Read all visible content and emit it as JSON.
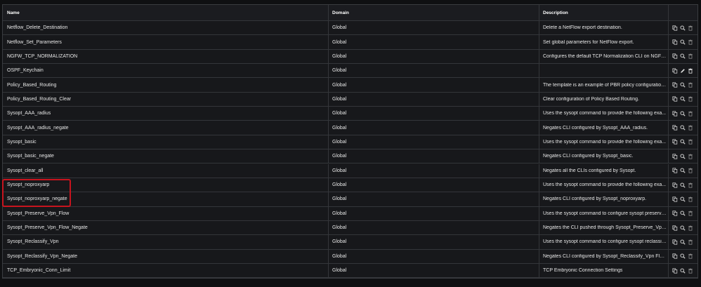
{
  "columns": {
    "name": "Name",
    "domain": "Domain",
    "description": "Description"
  },
  "rows": [
    {
      "name": "Netflow_Delete_Destination",
      "domain": "Global",
      "description": "Delete a NetFlow export destination.",
      "editable": false
    },
    {
      "name": "Netflow_Set_Parameters",
      "domain": "Global",
      "description": "Set global parameters for NetFlow export.",
      "editable": false
    },
    {
      "name": "NGFW_TCP_NORMALIZATION",
      "domain": "Global",
      "description": "Configures the default TCP Normalization CLI on NGFW.",
      "editable": false
    },
    {
      "name": "OSPF_Keychain",
      "domain": "Global",
      "description": "",
      "editable": true
    },
    {
      "name": "Policy_Based_Routing",
      "domain": "Global",
      "description": "The template is an example of PBR policy configuration....",
      "editable": false
    },
    {
      "name": "Policy_Based_Routing_Clear",
      "domain": "Global",
      "description": "Clear configuration of Policy Based Routing.",
      "editable": false
    },
    {
      "name": "Sysopt_AAA_radius",
      "domain": "Global",
      "description": "Uses the sysopt command to provide the following exa...",
      "editable": false
    },
    {
      "name": "Sysopt_AAA_radius_negate",
      "domain": "Global",
      "description": "Negates CLI configured by Sysopt_AAA_radius.",
      "editable": false
    },
    {
      "name": "Sysopt_basic",
      "domain": "Global",
      "description": "Uses the sysopt command to provide the following exa...",
      "editable": false
    },
    {
      "name": "Sysopt_basic_negate",
      "domain": "Global",
      "description": "Negates CLI configured by Sysopt_basic.",
      "editable": false
    },
    {
      "name": "Sysopt_clear_all",
      "domain": "Global",
      "description": "Negates all the CLIs configured by Sysopt.",
      "editable": false
    },
    {
      "name": "Sysopt_noproxyarp",
      "domain": "Global",
      "description": "Uses the sysopt command to provide the following exa...",
      "editable": false
    },
    {
      "name": "Sysopt_noproxyarp_negate",
      "domain": "Global",
      "description": "Negates CLI configured by Sysopt_noproxyarp.",
      "editable": false
    },
    {
      "name": "Sysopt_Preserve_Vpn_Flow",
      "domain": "Global",
      "description": "Uses the sysopt command to configure sysopt preserve ...",
      "editable": false
    },
    {
      "name": "Sysopt_Preserve_Vpn_Flow_Negate",
      "domain": "Global",
      "description": "Negates the CLI pushed through Sysopt_Preserve_Vpn_...",
      "editable": false
    },
    {
      "name": "Sysopt_Reclassify_Vpn",
      "domain": "Global",
      "description": "Uses the sysopt command to configure sysopt reclassify...",
      "editable": false
    },
    {
      "name": "Sysopt_Reclassify_Vpn_Negate",
      "domain": "Global",
      "description": "Negates CLI configured by Sysopt_Reclassify_Vpn Flex-...",
      "editable": false
    },
    {
      "name": "TCP_Embryonic_Conn_Limit",
      "domain": "Global",
      "description": "TCP Embryonic Connection Settings",
      "editable": false
    }
  ],
  "icons": {
    "copy": "copy-icon",
    "view": "search-icon",
    "edit": "pencil-icon",
    "delete": "trash-icon"
  },
  "colors": {
    "background": "#17181b",
    "highlight": "#c8141e",
    "text": "#e6e6e6"
  }
}
